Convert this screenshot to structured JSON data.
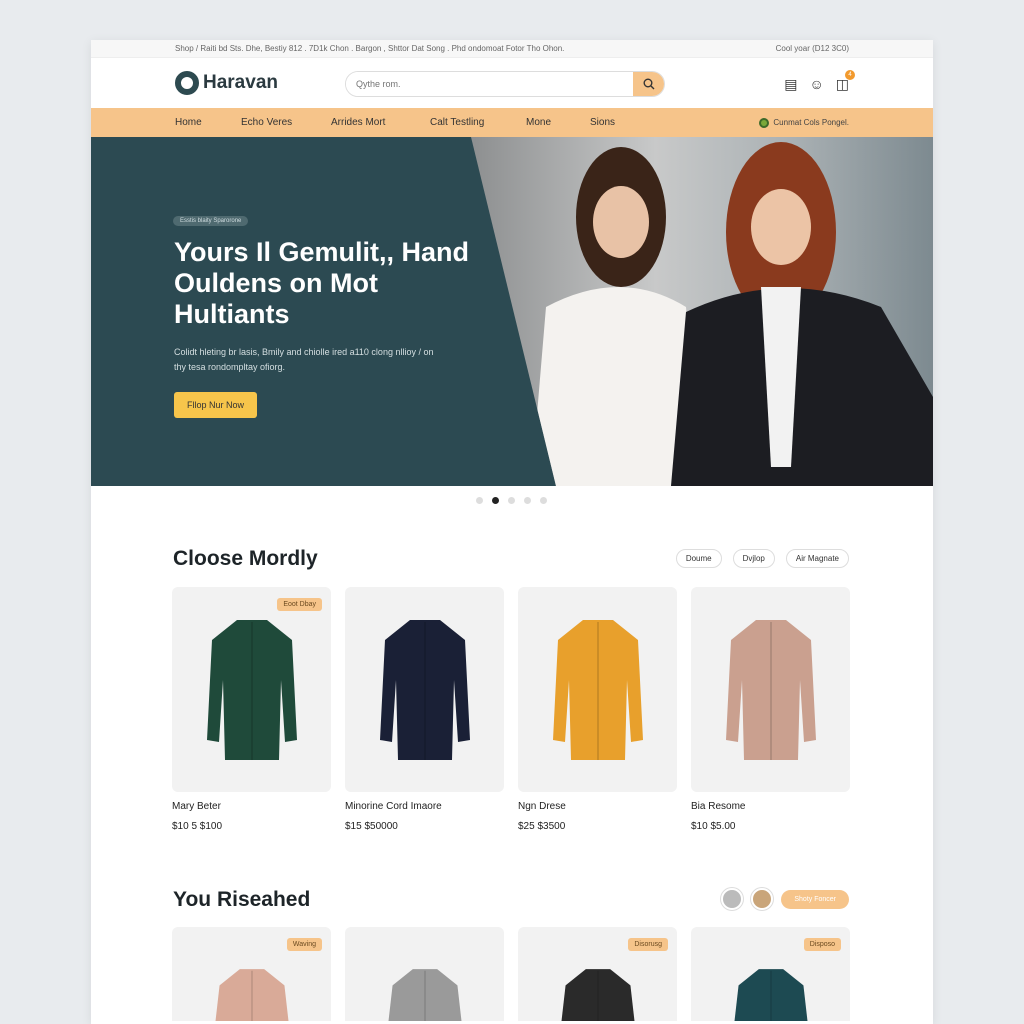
{
  "topbar": {
    "left": "Shop / Raiti bd Sts. Dhe, Bestiy 812 . 7D1k Chon . Bargon , Shttor Dat Song . Phd ondomoat Fotor Tho Ohon.",
    "right": "Cool yoar (D12 3C0)"
  },
  "header": {
    "logo": "Haravan",
    "search_placeholder": "Qythe rom.",
    "cart_count": "4",
    "icons": [
      "receipt-icon",
      "user-icon",
      "cart-icon"
    ]
  },
  "nav": {
    "items": [
      "Home",
      "Echo Veres",
      "Arrides Mort",
      "Calt Testling",
      "Mone",
      "Sions"
    ],
    "right": "Cunmat Cols Pongel."
  },
  "hero": {
    "pill": "Esstis blaity Sparorone",
    "title": "Yours Il Gemulit,, Hand Ouldens on Mot Hultiants",
    "subtitle": "Colidt hleting br lasis, Bmily and chiolle ired a110 clong nllioy / on thy tesa rondompltay ofiorg.",
    "cta": "Fllop Nur Now",
    "slides": 5,
    "active_slide": 2
  },
  "section1": {
    "title": "Cloose Mordly",
    "chips": [
      "Doume",
      "Dvjlop",
      "Air Magnate"
    ],
    "products": [
      {
        "name": "Mary Beter",
        "price": "$10 5 $100",
        "tag": "Eoot Dbay",
        "color": "#1f4a3a"
      },
      {
        "name": "Minorine Cord Imaore",
        "price": "$15 $50000",
        "tag": "",
        "color": "#1a2036"
      },
      {
        "name": "Ngn Drese",
        "price": "$25 $3500",
        "tag": "",
        "color": "#e8a02c"
      },
      {
        "name": "Bia Resome",
        "price": "$10 $5.00",
        "tag": "",
        "color": "#caa08f"
      }
    ]
  },
  "section2": {
    "title": "You Riseahed",
    "button": "Shoty Foncer",
    "products": [
      {
        "tag": "Waving",
        "color": "#d9aa98"
      },
      {
        "tag": "",
        "color": "#9a9a9a"
      },
      {
        "tag": "Disorusg",
        "color": "#2a2a2a"
      },
      {
        "tag": "Disposo",
        "color": "#1d4a52"
      }
    ]
  }
}
